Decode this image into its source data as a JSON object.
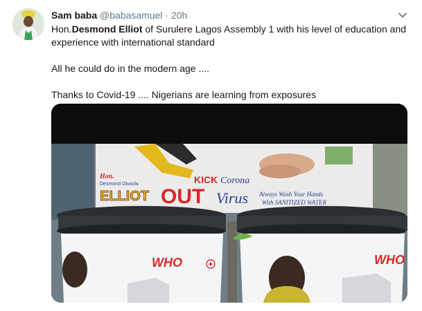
{
  "tweet": {
    "display_name": "Sam baba",
    "handle": "@babasamuel",
    "separator": "·",
    "timestamp": "20h",
    "text_lines": {
      "line1_prefix": "Hon.",
      "line1_bold": "Desmond Elliot",
      "line1_rest": " of Surulere Lagos Assembly 1 with his level of education and",
      "line2": "experience with international standard",
      "line3": "All he could do in the modern age ....",
      "line4": "Thanks to Covid-19 .... Nigerians are learning from exposures"
    },
    "more_icon": "chevron-down-icon"
  },
  "media": {
    "banner": {
      "hon": "Hon.",
      "name": "Desmond Olusola",
      "surname": "ELLIOT",
      "kick": "KICK",
      "corona": "Corona",
      "out": "OUT",
      "virus": "Virus",
      "wash1": "Always Wash Your Hands",
      "wash2": "With SANITIZED WATER"
    },
    "bucket_label_left": "WHO",
    "bucket_label_right": "WHO"
  },
  "colors": {
    "text": "#14171a",
    "muted": "#657786",
    "banner_red": "#d8262a",
    "banner_blue": "#2a3f8f"
  }
}
